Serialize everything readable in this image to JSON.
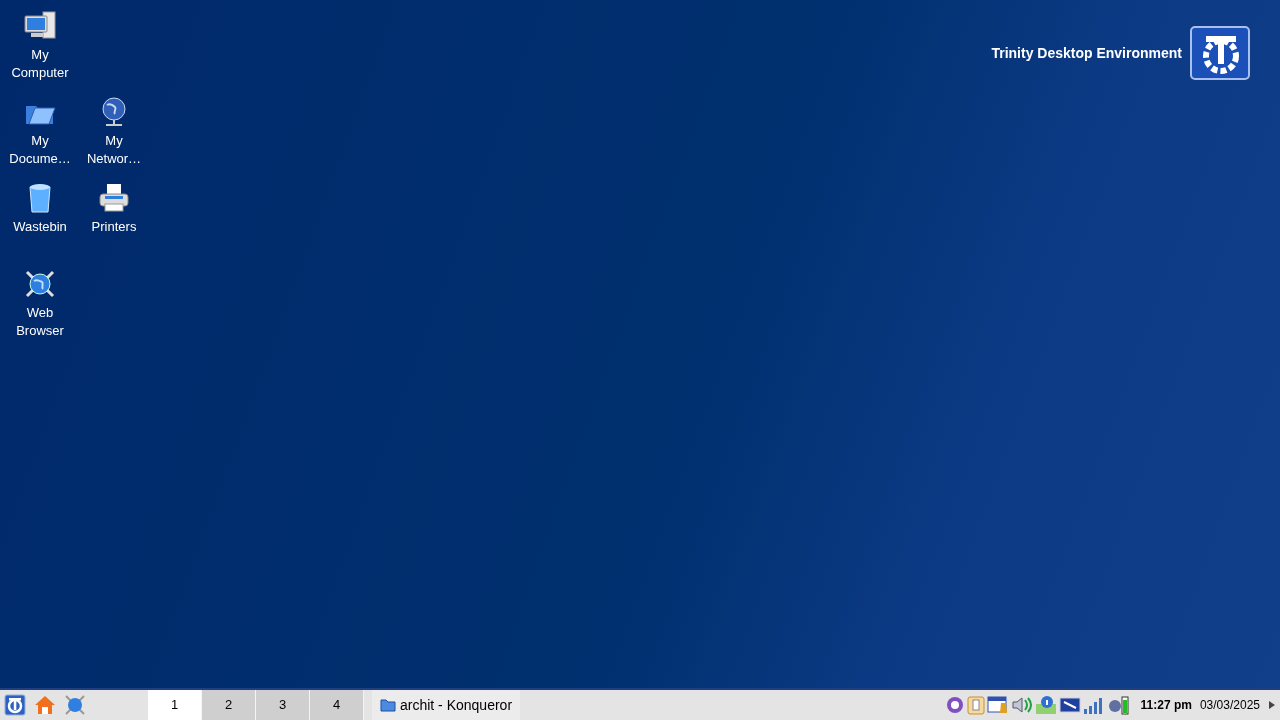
{
  "desktop_icons": [
    {
      "kind": "computer",
      "label": "My Computer"
    },
    {
      "kind": "documents",
      "label": "My Docume…"
    },
    {
      "kind": "network",
      "label": "My Networ…"
    },
    {
      "kind": "wastebin",
      "label": "Wastebin"
    },
    {
      "kind": "printer",
      "label": "Printers"
    },
    {
      "kind": "browser",
      "label": "Web Browser"
    }
  ],
  "branding": {
    "title": "Trinity Desktop Environment"
  },
  "taskbar": {
    "launchers": [
      {
        "kind": "menu"
      },
      {
        "kind": "home"
      },
      {
        "kind": "browser"
      }
    ],
    "pager": [
      {
        "label": "1",
        "selected": true
      },
      {
        "label": "2",
        "selected": false
      },
      {
        "label": "3",
        "selected": false
      },
      {
        "label": "4",
        "selected": false
      }
    ],
    "tasks": [
      {
        "title": "archit - Konqueror"
      }
    ],
    "tray": [
      {
        "kind": "settings"
      },
      {
        "kind": "klipper"
      },
      {
        "kind": "scheduler"
      },
      {
        "kind": "volume"
      },
      {
        "kind": "info"
      },
      {
        "kind": "display"
      },
      {
        "kind": "signal"
      },
      {
        "kind": "power"
      }
    ],
    "clock": {
      "time": "11:27 pm",
      "date": "03/03/2025"
    }
  }
}
